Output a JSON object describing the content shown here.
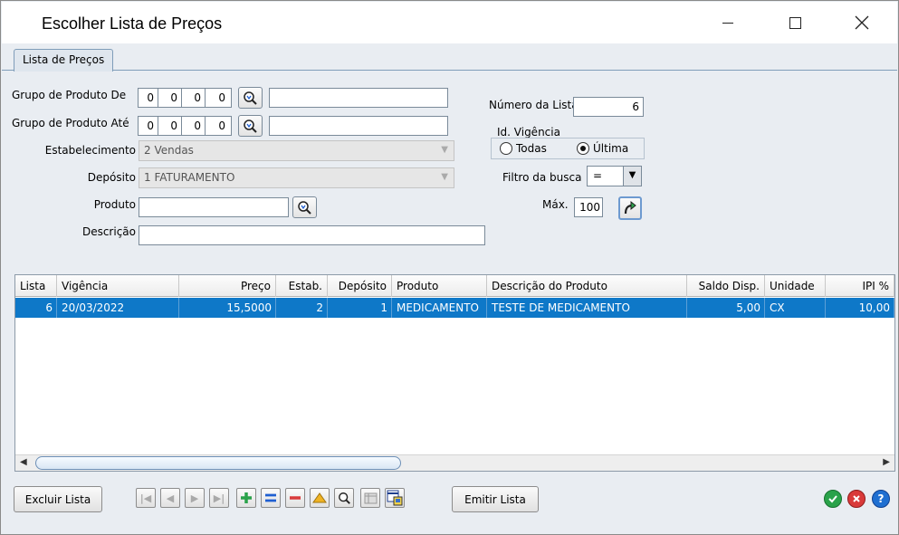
{
  "window": {
    "title": "Escolher Lista de Preços"
  },
  "tab": {
    "label": "Lista de Preços"
  },
  "form": {
    "grupo_de": {
      "label": "Grupo de Produto De",
      "digits": [
        "0",
        "0",
        "0",
        "0"
      ],
      "description": ""
    },
    "grupo_ate": {
      "label": "Grupo de Produto Até",
      "digits": [
        "0",
        "0",
        "0",
        "0"
      ],
      "description": ""
    },
    "estabelecimento": {
      "label": "Estabelecimento",
      "value": "2 Vendas"
    },
    "deposito": {
      "label": "Depósito",
      "value": "1 FATURAMENTO"
    },
    "produto": {
      "label": "Produto",
      "value": ""
    },
    "descricao": {
      "label": "Descrição",
      "value": ""
    },
    "numero_lista": {
      "label": "Número da Lista",
      "value": "6"
    },
    "vigencia": {
      "label": "Id. Vigência",
      "option_todas": "Todas",
      "option_ultima": "Última",
      "selected": "Última"
    },
    "filtro": {
      "label": "Filtro da busca",
      "value": "="
    },
    "max": {
      "label": "Máx.",
      "value": "100"
    }
  },
  "grid": {
    "columns": [
      "Lista",
      "Vigência",
      "Preço",
      "Estab.",
      "Depósito",
      "Produto",
      "Descrição do Produto",
      "Saldo Disp.",
      "Unidade",
      "IPI %"
    ],
    "rows": [
      {
        "lista": "6",
        "vigencia": "20/03/2022",
        "preco": "15,5000",
        "estab": "2",
        "deposito": "1",
        "produto": "MEDICAMENTO",
        "descricao": "TESTE DE MEDICAMENTO",
        "saldo": "5,00",
        "unidade": "CX",
        "ipi": "10,00"
      }
    ]
  },
  "toolbar": {
    "excluir_label": "Excluir Lista",
    "emitir_label": "Emitir Lista"
  },
  "colors": {
    "selection": "#0e78c8",
    "ok": "#2aa24a",
    "cancel": "#d93a3a",
    "help": "#1f6fd1"
  }
}
